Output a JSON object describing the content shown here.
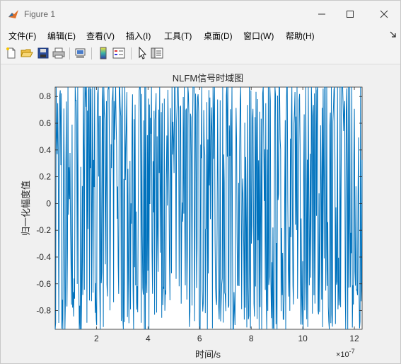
{
  "window": {
    "title": "Figure 1"
  },
  "menu": {
    "items": [
      "文件(F)",
      "编辑(E)",
      "查看(V)",
      "插入(I)",
      "工具(T)",
      "桌面(D)",
      "窗口(W)",
      "帮助(H)"
    ]
  },
  "toolbar": {
    "buttons": [
      "new-figure-icon",
      "open-file-icon",
      "save-icon",
      "print-icon",
      "link-plot-icon",
      "insert-colorbar-icon",
      "insert-legend-icon",
      "edit-plot-icon",
      "property-inspector-icon"
    ]
  },
  "colors": {
    "line": "#0072bd",
    "axes_bg": "#ffffff",
    "figure_bg": "#f0f0f0"
  },
  "chart_data": {
    "type": "line",
    "title": "NLFM信号时域图",
    "xlabel": "时间/s",
    "ylabel": "归一化幅度值",
    "x_exponent_label": "×10",
    "x_exponent_power": "-7",
    "xlim": [
      0.4,
      12.3
    ],
    "ylim": [
      -0.94,
      0.87
    ],
    "xticks": [
      2,
      4,
      6,
      8,
      10,
      12
    ],
    "xtick_labels": [
      "2",
      "4",
      "6",
      "8",
      "10",
      "12"
    ],
    "yticks": [
      -0.8,
      -0.6,
      -0.4,
      -0.2,
      0,
      0.2,
      0.4,
      0.6,
      0.8
    ],
    "ytick_labels": [
      "-0.8",
      "-0.6",
      "-0.4",
      "-0.2",
      "0",
      "0.2",
      "0.4",
      "0.6",
      "0.8"
    ],
    "grid": false,
    "series": [
      {
        "x_range": [
          0.4,
          12.3
        ],
        "samples": 600,
        "description_values": "dense oscillating signal between -0.94 and 0.87 across full time range"
      }
    ]
  }
}
